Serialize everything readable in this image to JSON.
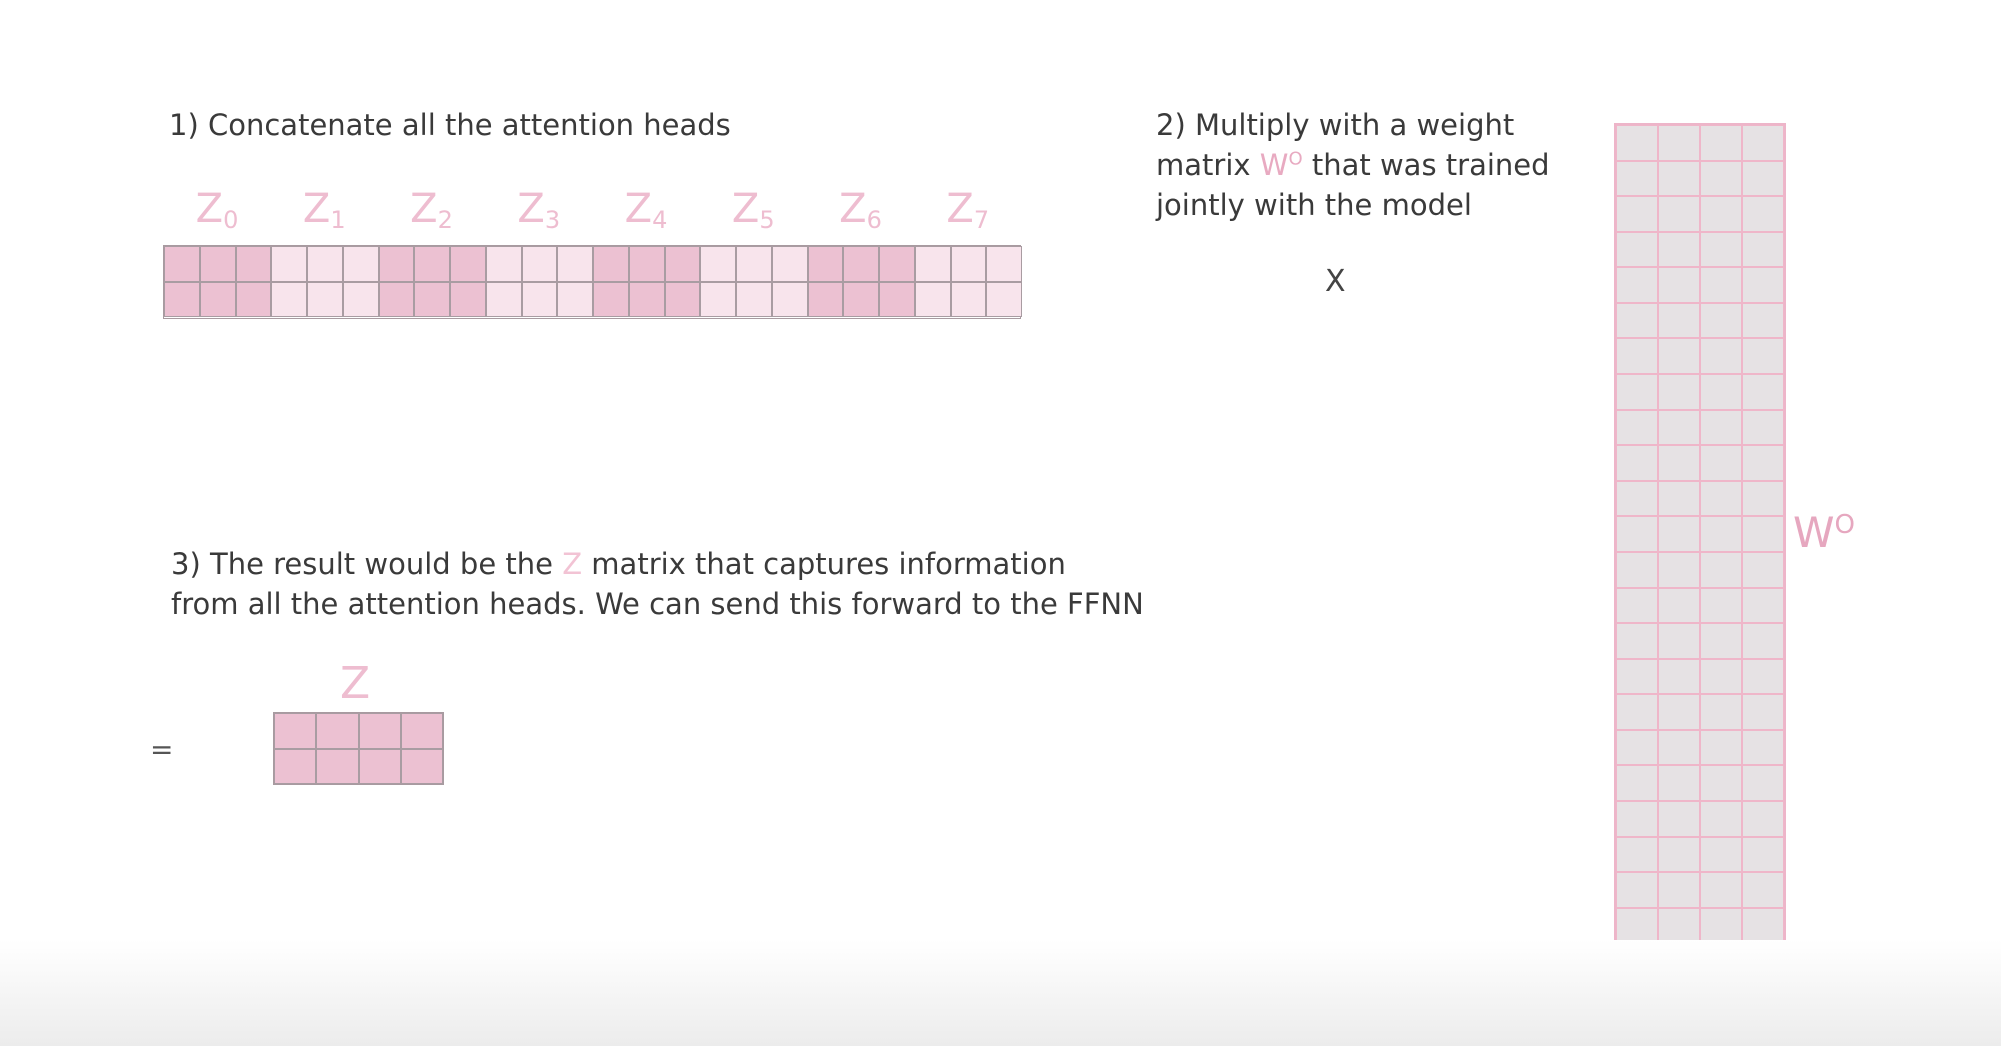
{
  "step1": {
    "text": "1) Concatenate all the attention heads"
  },
  "step2": {
    "line1": "2) Multiply with a weight",
    "line2_pre": "matrix ",
    "w_symbol": "W",
    "w_sup": "O",
    "line2_post": " that was trained",
    "line3": "jointly with the model"
  },
  "operator_times": "X",
  "step3": {
    "line1_pre": "3) The result would be the ",
    "z_symbol": "Z",
    "line1_post": " matrix that captures information",
    "line2": "from all the attention heads. We can send this forward to the FFNN"
  },
  "head_labels": [
    {
      "base": "Z",
      "sub": "0"
    },
    {
      "base": "Z",
      "sub": "1"
    },
    {
      "base": "Z",
      "sub": "2"
    },
    {
      "base": "Z",
      "sub": "3"
    },
    {
      "base": "Z",
      "sub": "4"
    },
    {
      "base": "Z",
      "sub": "5"
    },
    {
      "base": "Z",
      "sub": "6"
    },
    {
      "base": "Z",
      "sub": "7"
    }
  ],
  "wo_label": {
    "base": "W",
    "sup": "O"
  },
  "z_label": "Z",
  "operator_equals": "=",
  "colors": {
    "head_dark": "#ecc1d2",
    "head_light": "#f8e4ec",
    "weight_fill": "#e6e2e4",
    "weight_border": "#efb6c9",
    "label_pink": "#eebdd0"
  }
}
